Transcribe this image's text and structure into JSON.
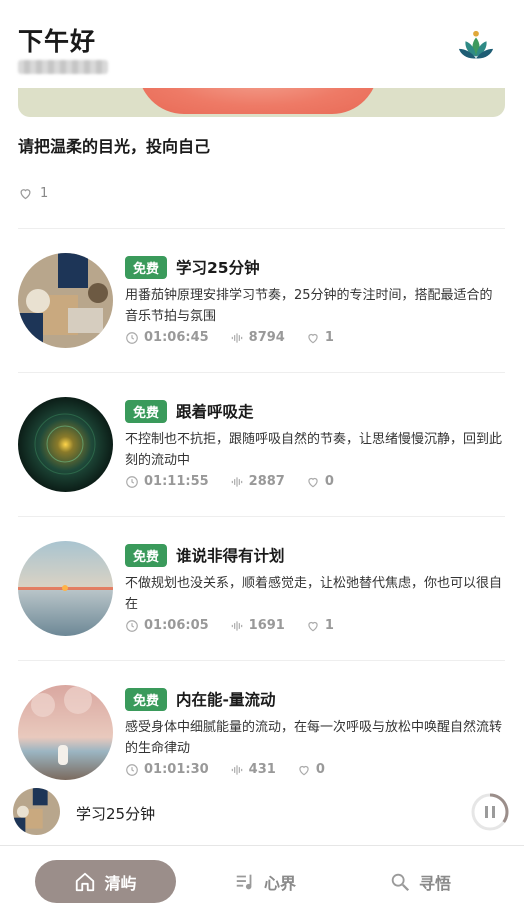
{
  "header": {
    "greeting": "下午好",
    "logo_icon": "lotus-logo-icon"
  },
  "featured": {
    "quote": "请把温柔的目光，投向自己",
    "likes": "1"
  },
  "tracks": [
    {
      "badge": "免费",
      "title": "学习25分钟",
      "description": "用番茄钟原理安排学习节奏，25分钟的专注时间，搭配最适合的音乐节拍与氛围",
      "duration": "01:06:45",
      "plays": "8794",
      "likes": "1"
    },
    {
      "badge": "免费",
      "title": "跟着呼吸走",
      "description": "不控制也不抗拒，跟随呼吸自然的节奏，让思绪慢慢沉静，回到此刻的流动中",
      "duration": "01:11:55",
      "plays": "2887",
      "likes": "0"
    },
    {
      "badge": "免费",
      "title": "谁说非得有计划",
      "description": "不做规划也没关系，顺着感觉走，让松弛替代焦虑，你也可以很自在",
      "duration": "01:06:05",
      "plays": "1691",
      "likes": "1"
    },
    {
      "badge": "免费",
      "title": "内在能-量流动",
      "description": "感受身体中细腻能量的流动，在每一次呼吸与放松中唤醒自然流转的生命律动",
      "duration": "01:01:30",
      "plays": "431",
      "likes": "0"
    }
  ],
  "player": {
    "title": "学习25分钟",
    "state": "playing",
    "progress": 0.35
  },
  "tabs": [
    {
      "label": "清屿",
      "icon": "home-icon",
      "active": true
    },
    {
      "label": "心界",
      "icon": "music-icon",
      "active": false
    },
    {
      "label": "寻悟",
      "icon": "search-icon",
      "active": false
    }
  ],
  "colors": {
    "badge": "#3a9a5b",
    "active_tab": "#9b8e8a"
  }
}
